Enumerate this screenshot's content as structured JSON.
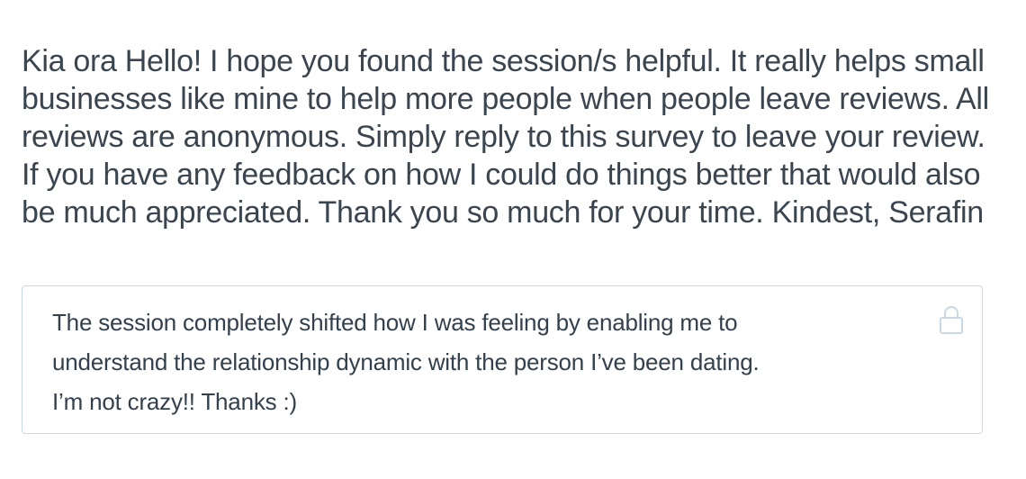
{
  "survey": {
    "question_text": "Kia ora Hello! I hope you found the session/s helpful. It really helps small businesses like mine to help more people when people leave reviews. All reviews are anonymous. Simply reply to this survey to leave your review. If you have any feedback on how I could do things better that would also be much appreciated. Thank you so much for your time. Kindest, Serafin",
    "answer": {
      "lines": [
        "The session completely shifted how I was feeling by enabling me to",
        "understand the relationship dynamic with the person I’ve been dating.",
        "I’m not crazy!! Thanks :)"
      ],
      "locked": true,
      "lock_icon": "lock-icon"
    }
  },
  "colors": {
    "text_primary": "#3a4550",
    "answer_text": "#33404d",
    "border": "#c8d8e4",
    "icon": "#c8d8e4"
  }
}
